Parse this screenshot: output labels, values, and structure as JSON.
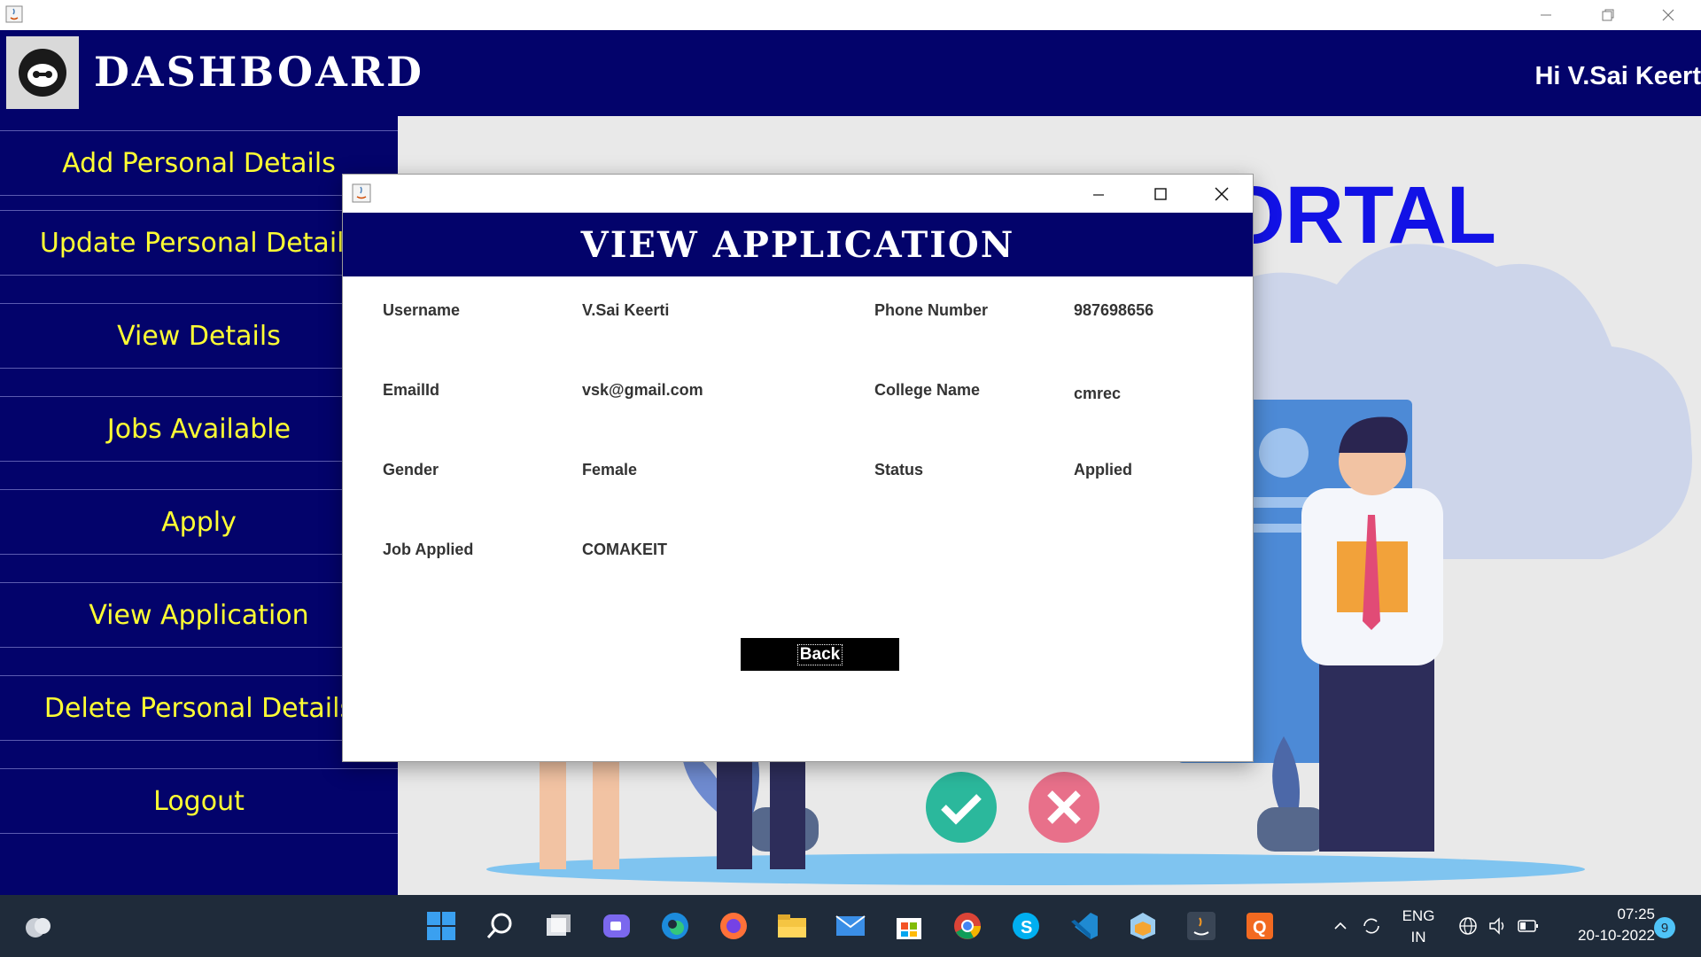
{
  "header": {
    "title": "DASHBOARD",
    "greeting": "Hi V.Sai Keert"
  },
  "sidebar": {
    "items": [
      {
        "label": "Add Personal Details"
      },
      {
        "label": "Update Personal Details"
      },
      {
        "label": "View Details"
      },
      {
        "label": "Jobs Available"
      },
      {
        "label": "Apply"
      },
      {
        "label": "View Application"
      },
      {
        "label": "Delete Personal Details"
      },
      {
        "label": "Logout"
      }
    ]
  },
  "background": {
    "portal_text": "ORTAL"
  },
  "dialog": {
    "heading": "VIEW APPLICATION",
    "fields": {
      "username": {
        "label": "Username",
        "value": "V.Sai Keerti"
      },
      "phone": {
        "label": "Phone Number",
        "value": "987698656"
      },
      "email": {
        "label": "EmailId",
        "value": "vsk@gmail.com"
      },
      "college": {
        "label": "College Name",
        "value": "cmrec"
      },
      "gender": {
        "label": "Gender",
        "value": "Female"
      },
      "status": {
        "label": "Status",
        "value": "Applied"
      },
      "job": {
        "label": "Job Applied",
        "value": "COMAKEIT"
      }
    },
    "back_label": "Back"
  },
  "taskbar": {
    "language": "ENG",
    "region": "IN",
    "time": "07:25",
    "date": "20-10-2022",
    "notification_count": "9",
    "apps": [
      "weather-icon",
      "start-icon",
      "search-icon",
      "task-view-icon",
      "chat-icon",
      "edge-icon",
      "firefox-icon",
      "file-explorer-icon",
      "mail-icon",
      "store-icon",
      "chrome-icon",
      "skype-icon",
      "vscode-icon",
      "netbeans-icon",
      "java-icon",
      "qbittorrent-icon"
    ]
  },
  "colors": {
    "header_bg": "#03036b",
    "sidebar_text": "#ffff33",
    "portal_text": "#1212e6",
    "taskbar_bg": "#1f2b3a"
  }
}
